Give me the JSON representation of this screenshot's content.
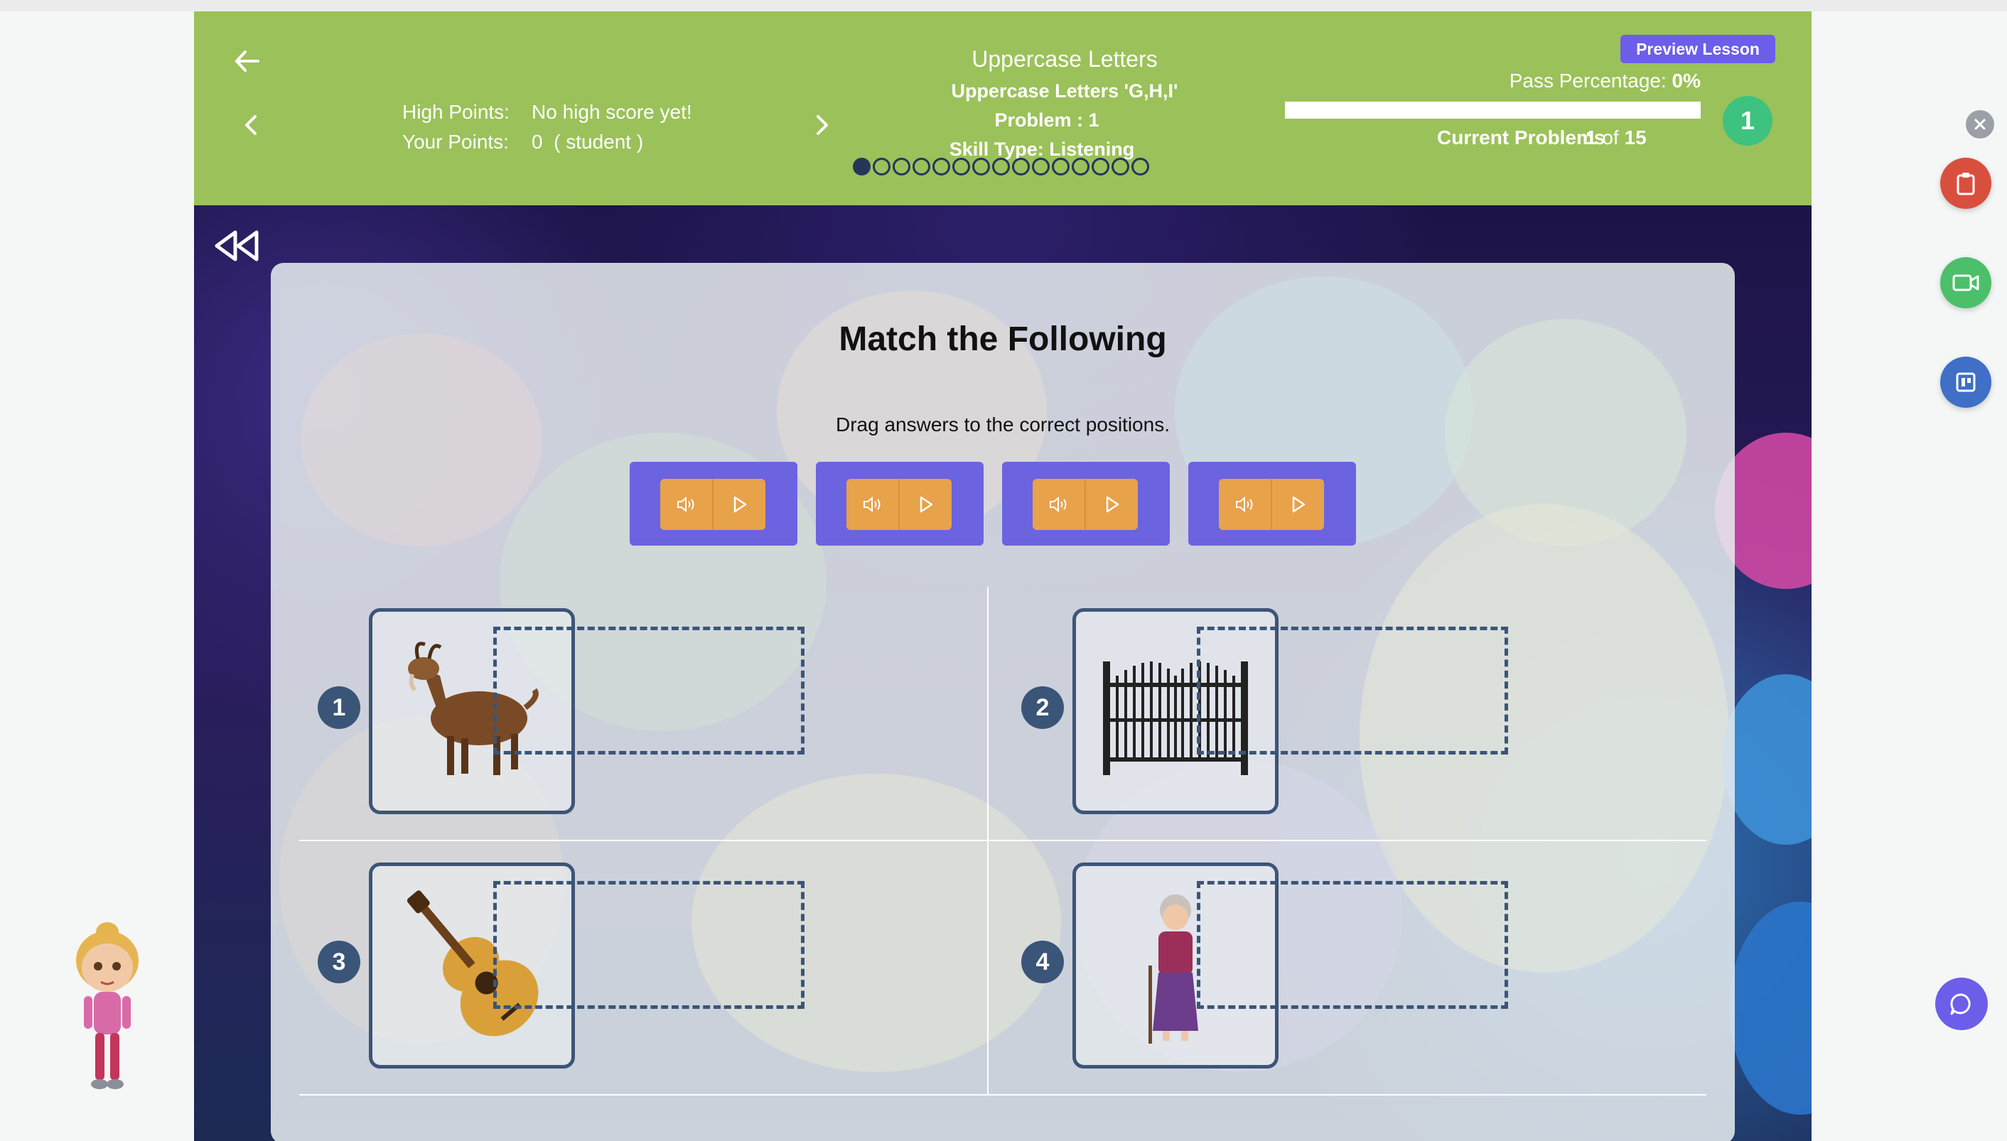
{
  "header": {
    "lesson_title": "Uppercase Letters",
    "lesson_subtitle": "Uppercase Letters 'G,H,I'",
    "problem_label": "Problem : 1",
    "skill_type": "Skill Type: Listening",
    "high_points_label": "High Points:",
    "high_points_value": "No high score yet!",
    "your_points_label": "Your Points:",
    "your_points_value": "0  ( student )",
    "preview_label": "Preview Lesson",
    "pass_label": "Pass Percentage:",
    "pass_value": "0%",
    "pass_fraction": 0,
    "current_label": "Current Problems",
    "current_num": "1",
    "current_of": "of",
    "current_total": "15",
    "attempt_badge": "1",
    "total_dots": 15,
    "active_dot": 1
  },
  "activity": {
    "title": "Match the Following",
    "instruction": "Drag answers to the correct positions.",
    "audio_tiles": 4,
    "items": [
      {
        "number": "1",
        "image": "goat"
      },
      {
        "number": "2",
        "image": "gate"
      },
      {
        "number": "3",
        "image": "guitar"
      },
      {
        "number": "4",
        "image": "grandmother"
      }
    ]
  },
  "colors": {
    "header_green": "#9bc15a",
    "accent_purple": "#6c5ee8",
    "audio_orange": "#e7a24a",
    "number_navy": "#3a5578",
    "dock_red": "#d94f3d",
    "dock_green": "#4cbf6b",
    "dock_blue": "#3f6fc6"
  },
  "icons": {
    "back": "arrow-left-icon",
    "prev": "chevron-left-icon",
    "next": "chevron-right-icon",
    "rewind": "rewind-icon",
    "speaker": "speaker-icon",
    "play": "play-icon",
    "close": "close-icon",
    "clipboard": "clipboard-icon",
    "video": "video-camera-icon",
    "board": "board-icon",
    "chat": "chat-icon"
  }
}
